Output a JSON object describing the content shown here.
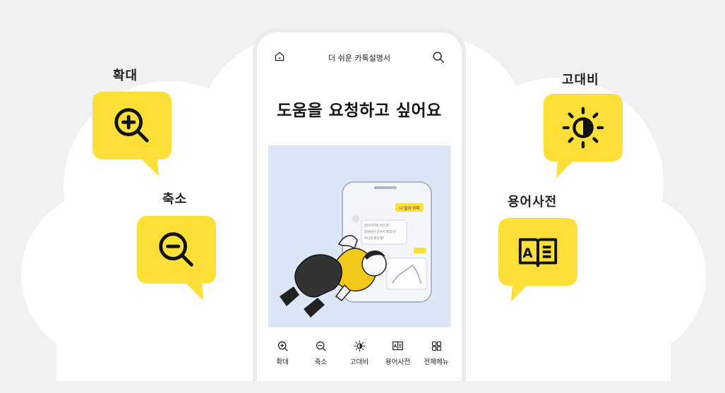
{
  "colors": {
    "accent_yellow": "#fde037",
    "background": "#f1f1f2",
    "cloud": "#ffffff",
    "illustration_bg": "#dbe7f6",
    "text": "#222222"
  },
  "callouts": {
    "zoom_in": {
      "label": "확대",
      "icon": "zoom-in-icon"
    },
    "zoom_out": {
      "label": "축소",
      "icon": "zoom-out-icon"
    },
    "contrast": {
      "label": "고대비",
      "icon": "contrast-sun-icon"
    },
    "dictionary": {
      "label": "용어사전",
      "icon": "dictionary-book-icon"
    }
  },
  "phone": {
    "header": {
      "title": "더 쉬운 카톡설명서",
      "home_icon": "home-icon",
      "search_icon": "search-icon"
    },
    "heading": "도움을 요청하고 싶어요",
    "illustration": {
      "chat_bubble_right": "나 말이 아파",
      "chat_bubble_left": [
        "할아버지께 어떤데?",
        "병원에서 앉아서 했겠어?",
        "아니면 확인해?"
      ]
    },
    "bottom_nav": [
      {
        "label": "확대",
        "icon": "zoom-in-icon"
      },
      {
        "label": "축소",
        "icon": "zoom-out-icon"
      },
      {
        "label": "고대비",
        "icon": "contrast-icon"
      },
      {
        "label": "용어사전",
        "icon": "dictionary-icon"
      },
      {
        "label": "전체메뉴",
        "icon": "grid-menu-icon"
      }
    ]
  }
}
